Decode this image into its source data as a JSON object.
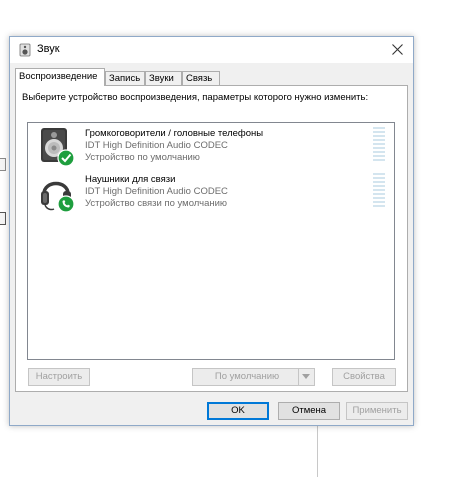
{
  "window": {
    "title": "Звук",
    "close_icon": "close-icon",
    "app_icon": "speaker-icon"
  },
  "tabs": [
    {
      "label": "Воспроизведение",
      "active": true
    },
    {
      "label": "Запись",
      "active": false
    },
    {
      "label": "Звуки",
      "active": false
    },
    {
      "label": "Связь",
      "active": false
    }
  ],
  "instruction": "Выберите устройство воспроизведения, параметры которого нужно изменить:",
  "devices": [
    {
      "name": "Громкоговорители / головные телефоны",
      "driver": "IDT High Definition Audio CODEC",
      "status": "Устройство по умолчанию",
      "icon": "speaker-icon",
      "badge": "check-icon"
    },
    {
      "name": "Наушники для связи",
      "driver": "IDT High Definition Audio CODEC",
      "status": "Устройство связи по умолчанию",
      "icon": "headset-icon",
      "badge": "phone-icon"
    }
  ],
  "buttons": {
    "configure": "Настроить",
    "set_default": "По умолчанию",
    "properties": "Свойства",
    "ok": "OK",
    "cancel": "Отмена",
    "apply": "Применить"
  },
  "colors": {
    "accent": "#0078d7",
    "status_green": "#1e9e3e",
    "meter": "#d4e5ef"
  }
}
